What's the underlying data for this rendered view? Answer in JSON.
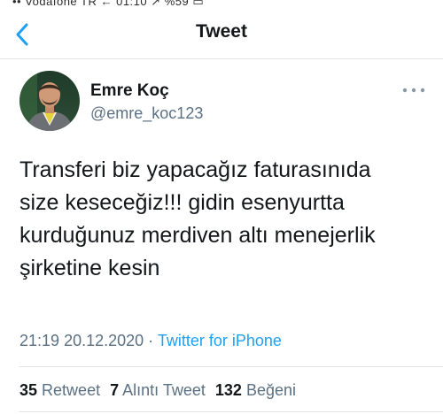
{
  "status_bar": {
    "partial_text": "•• Vodafone TR  ←          01:10          ↗ %59 ▭"
  },
  "header": {
    "title": "Tweet",
    "back_icon": "chevron-left-icon"
  },
  "author": {
    "name": "Emre Koç",
    "handle": "@emre_koc123"
  },
  "tweet": {
    "text": "Transferi biz yapacağız faturasınıda\nsize keseceğiz!!! gidin esenyurtta\nkurduğunuz merdiven altı menejerlik\nşirketine kesin",
    "time": "21:19",
    "date": "20.12.2020",
    "separator": "·",
    "source": "Twitter for iPhone"
  },
  "stats": {
    "retweets_count": "35",
    "retweets_label": "Retweet",
    "quotes_count": "7",
    "quotes_label": "Alıntı Tweet",
    "likes_count": "132",
    "likes_label": "Beğeni"
  },
  "colors": {
    "accent": "#1da1f2",
    "secondary_text": "#5b7083",
    "divider": "#dfe3e6"
  }
}
